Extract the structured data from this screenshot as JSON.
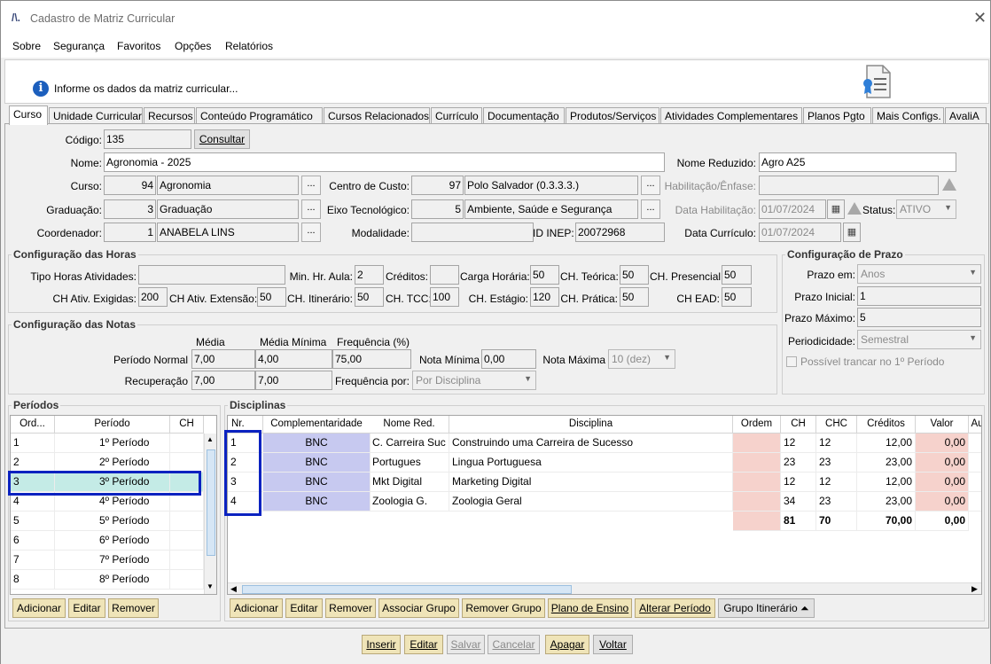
{
  "window": {
    "title": "Cadastro de Matriz Curricular",
    "logo": "/\\."
  },
  "menu": [
    "Sobre",
    "Segurança",
    "Favoritos",
    "Opções",
    "Relatórios"
  ],
  "info": {
    "text": "Informe os dados da matriz curricular..."
  },
  "tabs": [
    "Curso",
    "Unidade Curricular",
    "Recursos",
    "Conteúdo Programático",
    "Cursos Relacionados",
    "Currículo",
    "Documentação",
    "Produtos/Serviços",
    "Atividades Complementares",
    "Planos Pgto",
    "Mais Configs.",
    "AvaliA"
  ],
  "form": {
    "codigo_label": "Código:",
    "codigo": "135",
    "consultar": "Consultar",
    "nome_label": "Nome:",
    "nome": "Agronomia - 2025",
    "nome_reduzido_label": "Nome Reduzido:",
    "nome_reduzido": "Agro A25",
    "curso_label": "Curso:",
    "curso_id": "94",
    "curso_nome": "Agronomia",
    "centro_label": "Centro de Custo:",
    "centro_id": "97",
    "centro_nome": "Polo Salvador (0.3.3.3.)",
    "habilitacao_label": "Habilitação/Ênfase:",
    "graduacao_label": "Graduação:",
    "graduacao_id": "3",
    "graduacao_nome": "Graduação",
    "eixo_label": "Eixo Tecnológico:",
    "eixo_id": "5",
    "eixo_nome": "Ambiente, Saúde e Segurança",
    "data_hab_label": "Data Habilitação:",
    "data_hab": "01/07/2024",
    "status_label": "Status:",
    "status": "ATIVO",
    "coordenador_label": "Coordenador:",
    "coordenador_id": "1",
    "coordenador_nome": "ANABELA LINS",
    "modalidade_label": "Modalidade:",
    "inep_label": "ID INEP:",
    "inep": "20072968",
    "data_curr_label": "Data Currículo:",
    "data_curr": "01/07/2024",
    "dots": "..."
  },
  "horas": {
    "title": "Configuração das Horas",
    "tipo_label": "Tipo Horas Atividades:",
    "min_label": "Min. Hr. Aula:",
    "min": "2",
    "creditos_label": "Créditos:",
    "carga_label": "Carga Horária:",
    "carga": "50",
    "teorica_label": "CH. Teórica:",
    "teorica": "50",
    "presencial_label": "CH. Presencial:",
    "presencial": "50",
    "exigidas_label": "CH Ativ. Exigidas:",
    "exigidas": "200",
    "extensao_label": "CH Ativ. Extensão:",
    "extensao": "50",
    "itinerario_label": "CH. Itinerário:",
    "itinerario": "50",
    "tcc_label": "CH. TCC:",
    "tcc": "100",
    "estagio_label": "CH. Estágio:",
    "estagio": "120",
    "pratica_label": "CH. Prática:",
    "pratica": "50",
    "ead_label": "CH EAD:",
    "ead": "50"
  },
  "prazo": {
    "title": "Configuração de Prazo",
    "prazo_em_label": "Prazo em:",
    "prazo_em": "Anos",
    "inicial_label": "Prazo Inicial:",
    "inicial": "1",
    "maximo_label": "Prazo Máximo:",
    "maximo": "5",
    "periodicidade_label": "Periodicidade:",
    "periodicidade": "Semestral",
    "trancar_label": "Possível trancar no 1º Período"
  },
  "notas": {
    "title": "Configuração das Notas",
    "media_h": "Média",
    "media_min_h": "Média Mínima",
    "freq_h": "Frequência (%)",
    "normal_label": "Período Normal",
    "normal_media": "7,00",
    "normal_min": "4,00",
    "normal_freq": "75,00",
    "nota_min_label": "Nota Mínima",
    "nota_min": "0,00",
    "nota_max_label": "Nota Máxima",
    "nota_max": "10 (dez)",
    "rec_label": "Recuperação",
    "rec_media": "7,00",
    "rec_min": "7,00",
    "freq_por_label": "Frequência por:",
    "freq_por": "Por Disciplina"
  },
  "periodos": {
    "title": "Períodos",
    "headers": [
      "Ord...",
      "Período",
      "CH"
    ],
    "rows": [
      [
        "1",
        "1º Período"
      ],
      [
        "2",
        "2º Período"
      ],
      [
        "3",
        "3º Período"
      ],
      [
        "4",
        "4º Período"
      ],
      [
        "5",
        "5º Período"
      ],
      [
        "6",
        "6º Período"
      ],
      [
        "7",
        "7º Período"
      ],
      [
        "8",
        "8º Período"
      ]
    ],
    "buttons": [
      "Adicionar",
      "Editar",
      "Remover"
    ]
  },
  "disciplinas": {
    "title": "Disciplinas",
    "headers": [
      "Nr.",
      "Complementaridade",
      "Nome Red.",
      "Disciplina",
      "Ordem",
      "CH",
      "CHC",
      "Créditos",
      "Valor",
      "Au"
    ],
    "rows": [
      [
        "1",
        "BNC",
        "C. Carreira Suc",
        "Construindo uma Carreira de Sucesso",
        "",
        "12",
        "12",
        "12,00",
        "0,00"
      ],
      [
        "2",
        "BNC",
        "Portugues",
        "Lingua Portuguesa",
        "",
        "23",
        "23",
        "23,00",
        "0,00"
      ],
      [
        "3",
        "BNC",
        "Mkt Digital",
        "Marketing Digital",
        "",
        "12",
        "12",
        "12,00",
        "0,00"
      ],
      [
        "4",
        "BNC",
        "Zoologia G.",
        "Zoologia Geral",
        "",
        "34",
        "23",
        "23,00",
        "0,00"
      ]
    ],
    "totals": {
      "ch": "81",
      "chc": "70",
      "creditos": "70,00",
      "valor": "0,00"
    },
    "buttons": [
      "Adicionar",
      "Editar",
      "Remover",
      "Associar Grupo",
      "Remover Grupo",
      "Plano de Ensino",
      "Alterar Período",
      "Grupo Itinerário ⏶"
    ]
  },
  "footer": [
    "Inserir",
    "Editar",
    "Salvar",
    "Cancelar",
    "Apagar",
    "Voltar"
  ],
  "colors": {
    "accent": "#0b22c0",
    "bnc": "#c7c9f0",
    "pink": "#f6d2cc",
    "tan": "#efe4b8",
    "selected": "#c4ebe6"
  }
}
